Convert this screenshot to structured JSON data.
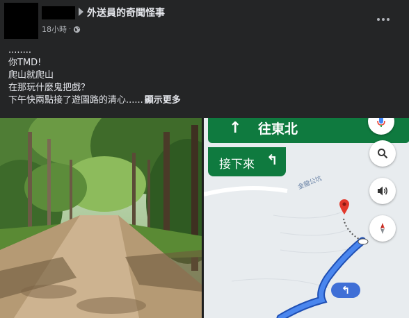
{
  "post": {
    "group_name": "外送員的奇聞怪事",
    "time": "18小時",
    "separator": "·",
    "lines": [
      "........",
      "你TMD!",
      "爬山就爬山",
      "在那玩什麼鬼把戲？"
    ],
    "last_line": "下午快兩點接了遊園路的清心......",
    "see_more": "顯示更多"
  },
  "map": {
    "direction": "往東北",
    "direction_arrow": "↑",
    "next_label": "接下來",
    "next_arrow": "↰",
    "road_label": "金龍公坑",
    "turn_arrow": "↰"
  },
  "icons": {
    "privacy": "globe-icon",
    "options": "more-options-icon",
    "voice": "mic-icon",
    "search": "search-icon",
    "sound": "speaker-icon",
    "compass": "compass-icon",
    "destination": "map-pin-icon"
  },
  "colors": {
    "background": "#242526",
    "text": "#e4e6eb",
    "muted": "#b0b3b8",
    "nav_green": "#0f7a3f",
    "route_blue": "#3f6fd6",
    "pin_red": "#e2382b"
  }
}
